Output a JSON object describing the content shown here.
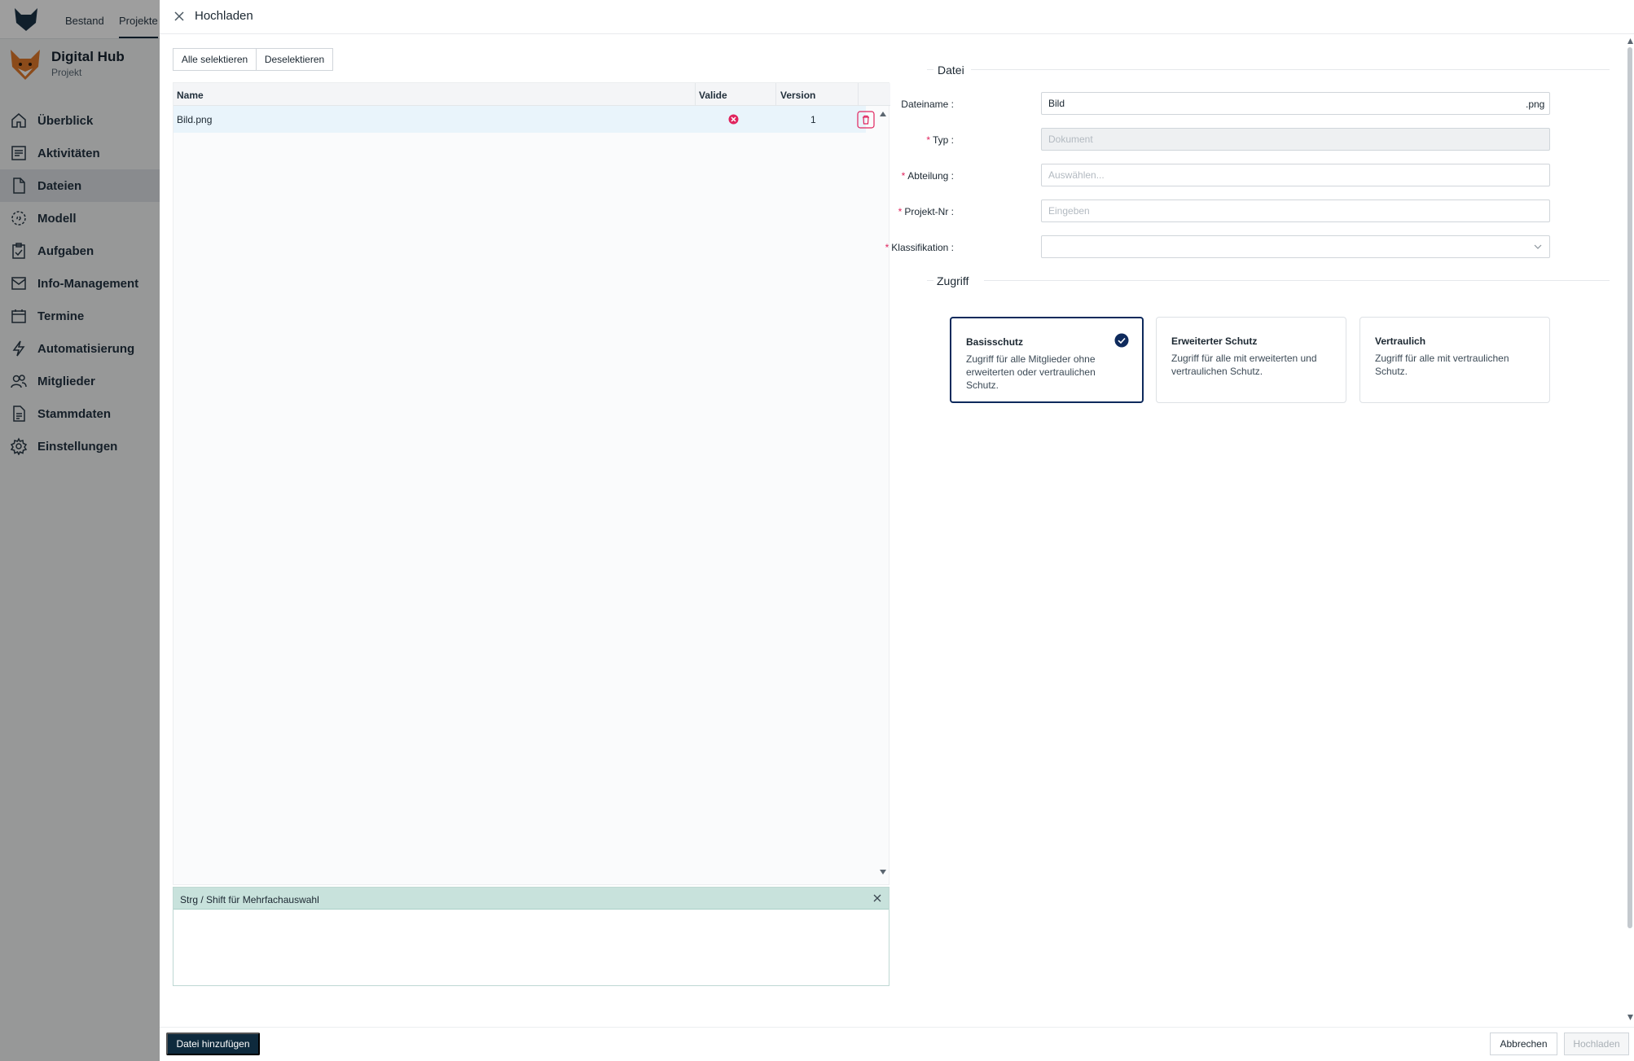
{
  "topnav": {
    "items": [
      {
        "label": "Bestand",
        "active": false
      },
      {
        "label": "Projekte",
        "active": true
      }
    ]
  },
  "project": {
    "name": "Digital Hub",
    "subtitle": "Projekt"
  },
  "nav": {
    "items": [
      {
        "label": "Überblick",
        "icon": "home-icon"
      },
      {
        "label": "Aktivitäten",
        "icon": "activity-icon"
      },
      {
        "label": "Dateien",
        "icon": "file-icon",
        "active": true
      },
      {
        "label": "Modell",
        "icon": "model-icon"
      },
      {
        "label": "Aufgaben",
        "icon": "tasks-icon"
      },
      {
        "label": "Info-Management",
        "icon": "inbox-icon"
      },
      {
        "label": "Termine",
        "icon": "calendar-icon"
      },
      {
        "label": "Automatisierung",
        "icon": "lightning-icon"
      },
      {
        "label": "Mitglieder",
        "icon": "members-icon"
      },
      {
        "label": "Stammdaten",
        "icon": "document-icon"
      },
      {
        "label": "Einstellungen",
        "icon": "gear-icon"
      }
    ]
  },
  "drawer": {
    "title": "Hochladen",
    "select_all": "Alle selektieren",
    "deselect": "Deselektieren",
    "table": {
      "columns": [
        "Name",
        "Valide",
        "Version"
      ],
      "rows": [
        {
          "name": "Bild.png",
          "valid": false,
          "version": "1"
        }
      ]
    },
    "hint": "Strg / Shift für Mehrfachauswahl",
    "add_file": "Datei hinzufügen",
    "cancel": "Abbrechen",
    "upload": "Hochladen"
  },
  "form": {
    "section_file": "Datei",
    "section_access": "Zugriff",
    "fields": {
      "filename": {
        "label": "Dateiname",
        "value": "Bild",
        "suffix": ".png"
      },
      "type": {
        "label": "Typ",
        "placeholder": "Dokument"
      },
      "department": {
        "label": "Abteilung",
        "placeholder": "Auswählen..."
      },
      "project_no": {
        "label": "Projekt-Nr",
        "placeholder": "Eingeben"
      },
      "classification": {
        "label": "Klassifikation",
        "value": ""
      }
    },
    "access_cards": [
      {
        "title": "Basisschutz",
        "desc": "Zugriff für alle Mitglieder ohne erweiterten oder vertraulichen Schutz.",
        "selected": true
      },
      {
        "title": "Erweiterter Schutz",
        "desc": "Zugriff für alle mit erweiterten und vertraulichen Schutz.",
        "selected": false
      },
      {
        "title": "Vertraulich",
        "desc": "Zugriff für alle mit vertraulichen Schutz.",
        "selected": false
      }
    ]
  },
  "colors": {
    "primary": "#0e2a3d",
    "accent": "#0e2a5c",
    "error": "#e0245e",
    "hint_bg": "#c8e2dc"
  }
}
